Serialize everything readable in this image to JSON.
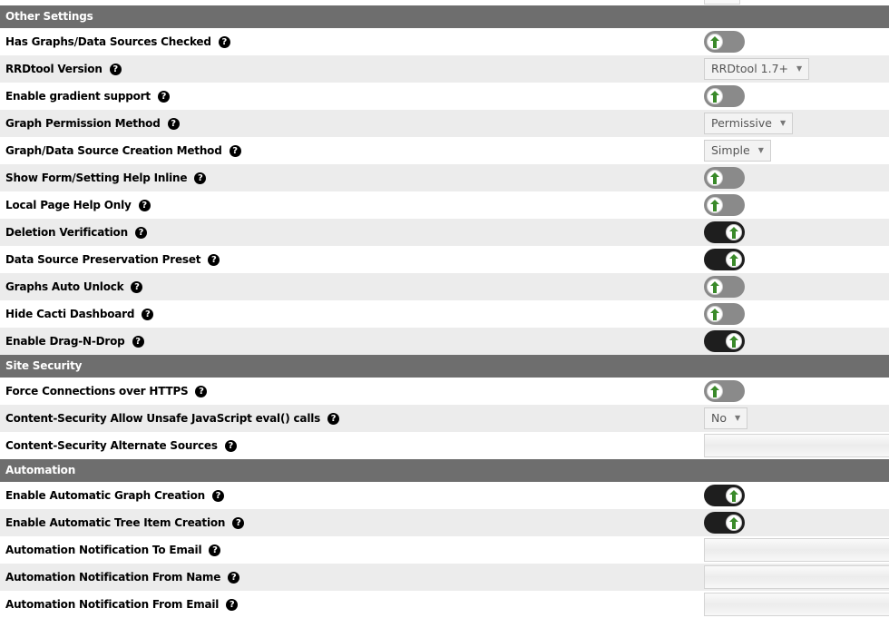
{
  "sections": [
    {
      "title": "Other Settings",
      "rows": [
        {
          "label": "Has Graphs/Data Sources Checked",
          "control": "toggle",
          "state": "off"
        },
        {
          "label": "RRDtool Version",
          "control": "select",
          "value": "RRDtool 1.7+"
        },
        {
          "label": "Enable gradient support",
          "control": "toggle",
          "state": "off"
        },
        {
          "label": "Graph Permission Method",
          "control": "select",
          "value": "Permissive"
        },
        {
          "label": "Graph/Data Source Creation Method",
          "control": "select",
          "value": "Simple"
        },
        {
          "label": "Show Form/Setting Help Inline",
          "control": "toggle",
          "state": "off"
        },
        {
          "label": "Local Page Help Only",
          "control": "toggle",
          "state": "off"
        },
        {
          "label": "Deletion Verification",
          "control": "toggle",
          "state": "on"
        },
        {
          "label": "Data Source Preservation Preset",
          "control": "toggle",
          "state": "on"
        },
        {
          "label": "Graphs Auto Unlock",
          "control": "toggle",
          "state": "off"
        },
        {
          "label": "Hide Cacti Dashboard",
          "control": "toggle",
          "state": "off"
        },
        {
          "label": "Enable Drag-N-Drop",
          "control": "toggle",
          "state": "on"
        }
      ]
    },
    {
      "title": "Site Security",
      "rows": [
        {
          "label": "Force Connections over HTTPS",
          "control": "toggle",
          "state": "off"
        },
        {
          "label": "Content-Security Allow Unsafe JavaScript eval() calls",
          "control": "select",
          "value": "No"
        },
        {
          "label": "Content-Security Alternate Sources",
          "control": "text",
          "value": ""
        }
      ]
    },
    {
      "title": "Automation",
      "rows": [
        {
          "label": "Enable Automatic Graph Creation",
          "control": "toggle",
          "state": "on"
        },
        {
          "label": "Enable Automatic Tree Item Creation",
          "control": "toggle",
          "state": "on"
        },
        {
          "label": "Automation Notification To Email",
          "control": "text",
          "value": ""
        },
        {
          "label": "Automation Notification From Name",
          "control": "text",
          "value": ""
        },
        {
          "label": "Automation Notification From Email",
          "control": "text",
          "value": ""
        }
      ]
    }
  ],
  "icons": {
    "help": "question-circle-icon",
    "toggle_knob": "green-arrow-up-icon",
    "select_caret": "caret-down-icon"
  },
  "help_glyph": "?",
  "caret_glyph": "▼",
  "colors": {
    "section_header_bg": "#6e6e6e",
    "row_alt_bg": "#ececec",
    "toggle_on": "#1e1e1e",
    "toggle_off": "#8a8a8a",
    "knob_arrow": "#3a8a2a"
  }
}
